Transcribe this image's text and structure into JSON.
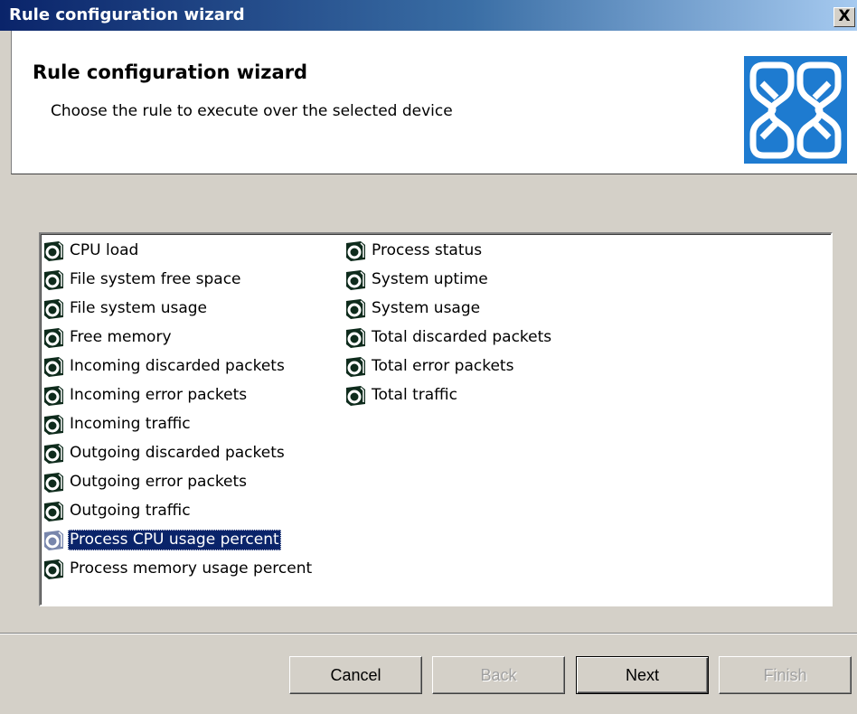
{
  "window": {
    "title": "Rule configuration wizard",
    "close_label": "X"
  },
  "header": {
    "title": "Rule configuration wizard",
    "subtitle": "Choose the rule to execute over the selected device",
    "logo_icon": "knot-logo-icon",
    "logo_color": "#1e7bd0"
  },
  "rules": {
    "icon": "rule-icon",
    "selected": "Process CPU usage percent",
    "column1": [
      "CPU load",
      "File system free space",
      "File system usage",
      "Free memory",
      "Incoming discarded packets",
      "Incoming error packets",
      "Incoming traffic",
      "Outgoing discarded packets",
      "Outgoing error packets",
      "Outgoing traffic",
      "Process CPU usage percent",
      "Process memory usage percent"
    ],
    "column2": [
      "Process status",
      "System uptime",
      "System usage",
      "Total discarded packets",
      "Total error packets",
      "Total traffic"
    ]
  },
  "buttons": {
    "cancel": "Cancel",
    "back": "Back",
    "next": "Next",
    "finish": "Finish"
  }
}
